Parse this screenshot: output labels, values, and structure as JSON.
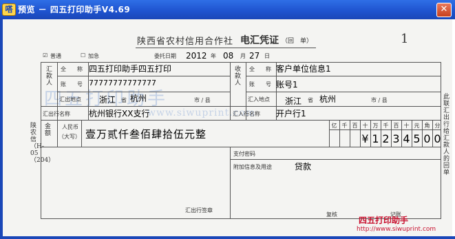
{
  "window": {
    "title": "预览 － 四五打印助手V4.69",
    "app_icon": "嗒",
    "close_glyph": "✕"
  },
  "form": {
    "heading": "陕西省农村信用合作社",
    "heading_bold": "电汇凭证",
    "copy_label": "（回　单）",
    "copy_no": "1",
    "normal_label": "普通",
    "urgent_label": "加急",
    "normal_checked": true,
    "date_label": "委托日期",
    "date_year": "2012",
    "year_label": "年",
    "date_month": "08",
    "month_label": "月",
    "date_day": "27",
    "day_label": "日",
    "remitter_label": "汇款人",
    "payee_label": "收款人",
    "fullname_label": "全　　称",
    "account_label": "账　　号",
    "remit_place_label": "汇出地点",
    "receive_place_label": "汇入地点",
    "province_label": "省",
    "city_label": "市 / 县",
    "remit_bank_label": "汇出行名称",
    "receive_bank_label": "汇入行名称",
    "amount_label": "金额",
    "rmb_label": "人民币",
    "rmb_sub": "（大写）",
    "units": [
      "亿",
      "千",
      "百",
      "十",
      "万",
      "千",
      "百",
      "十",
      "元",
      "角",
      "分"
    ],
    "pay_pwd_label": "支付密码",
    "extra_info_label": "附加信息及用途",
    "remit_sign_label": "汇出行签章",
    "review_label": "复核",
    "record_label": "记账",
    "side_left": "陕农信（H-05（204）",
    "side_right": "此联汇出行给汇款人的回单",
    "watermark_text": "四五打印助手",
    "watermark_url": "www.siwuprint.com"
  },
  "values": {
    "remitter_name": "四五打印助手四五打印",
    "remitter_account": "77777777777777",
    "remitter_province": "浙江",
    "remitter_city": "杭州",
    "remitter_bank": "杭州银行XX支行",
    "payee_name": "客户单位信息1",
    "payee_account": "账号1",
    "payee_province": "浙江",
    "payee_city": "杭州",
    "payee_bank": "开户行1",
    "amount_words": "壹万贰仟叁佰肆拾伍元整",
    "amount_digits": [
      "",
      "",
      "",
      "¥",
      "1",
      "2",
      "3",
      "4",
      "5",
      "0",
      "0"
    ],
    "purpose": "贷款"
  },
  "footer": {
    "brand": "四五打印助手",
    "url": "http://www.siwuprint.com"
  },
  "colors": {
    "titlebar": "#1f54d0",
    "brand_red": "#c8102e",
    "watermark": "#c5d2e6"
  }
}
